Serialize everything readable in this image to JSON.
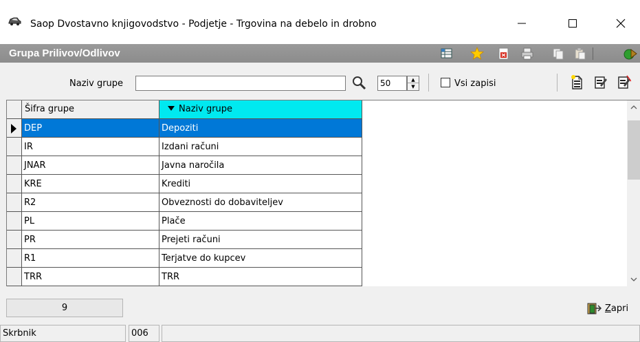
{
  "window": {
    "title": "Saop Dvostavno knjigovodstvo - Podjetje - Trgovina na debelo in drobno",
    "app_icon": "car-icon",
    "controls": {
      "minimize": "minimize-icon",
      "maximize": "maximize-icon",
      "close": "close-icon"
    }
  },
  "header": {
    "title": "Grupa Prilivov/Odlivov",
    "icons": [
      "table-icon",
      "star-icon",
      "pdf-icon",
      "print-icon",
      "copy-icon",
      "paste-icon",
      "exit-icon"
    ]
  },
  "filter": {
    "label": "Naziv grupe",
    "value": "",
    "count_value": "50",
    "all_records_label": "Vsi zapisi",
    "all_records_checked": false,
    "tool_icons": [
      "new-record-icon",
      "edit-record-icon",
      "edit-record-alt-icon"
    ]
  },
  "table": {
    "columns": [
      "Šifra grupe",
      "Naziv grupe"
    ],
    "sorted_column": 1,
    "selected_row": 0,
    "rows": [
      {
        "code": "DEP",
        "name": "Depoziti"
      },
      {
        "code": "IR",
        "name": "Izdani računi"
      },
      {
        "code": "JNAR",
        "name": "Javna naročila"
      },
      {
        "code": "KRE",
        "name": "Krediti"
      },
      {
        "code": "R2",
        "name": "Obveznosti do dobaviteljev"
      },
      {
        "code": "PL",
        "name": "Plače"
      },
      {
        "code": "PR",
        "name": "Prejeti računi"
      },
      {
        "code": "R1",
        "name": "Terjatve do kupcev"
      },
      {
        "code": "TRR",
        "name": "TRR"
      }
    ]
  },
  "footer": {
    "record_count": "9",
    "close_label_underlined": "Z",
    "close_label_rest": "apri"
  },
  "status": {
    "user_label": "Skrbnik",
    "code": "006",
    "info": ""
  },
  "colors": {
    "selection": "#0078d7",
    "sorted_header": "#00e9f0",
    "group_header": "#8c8c8c"
  }
}
